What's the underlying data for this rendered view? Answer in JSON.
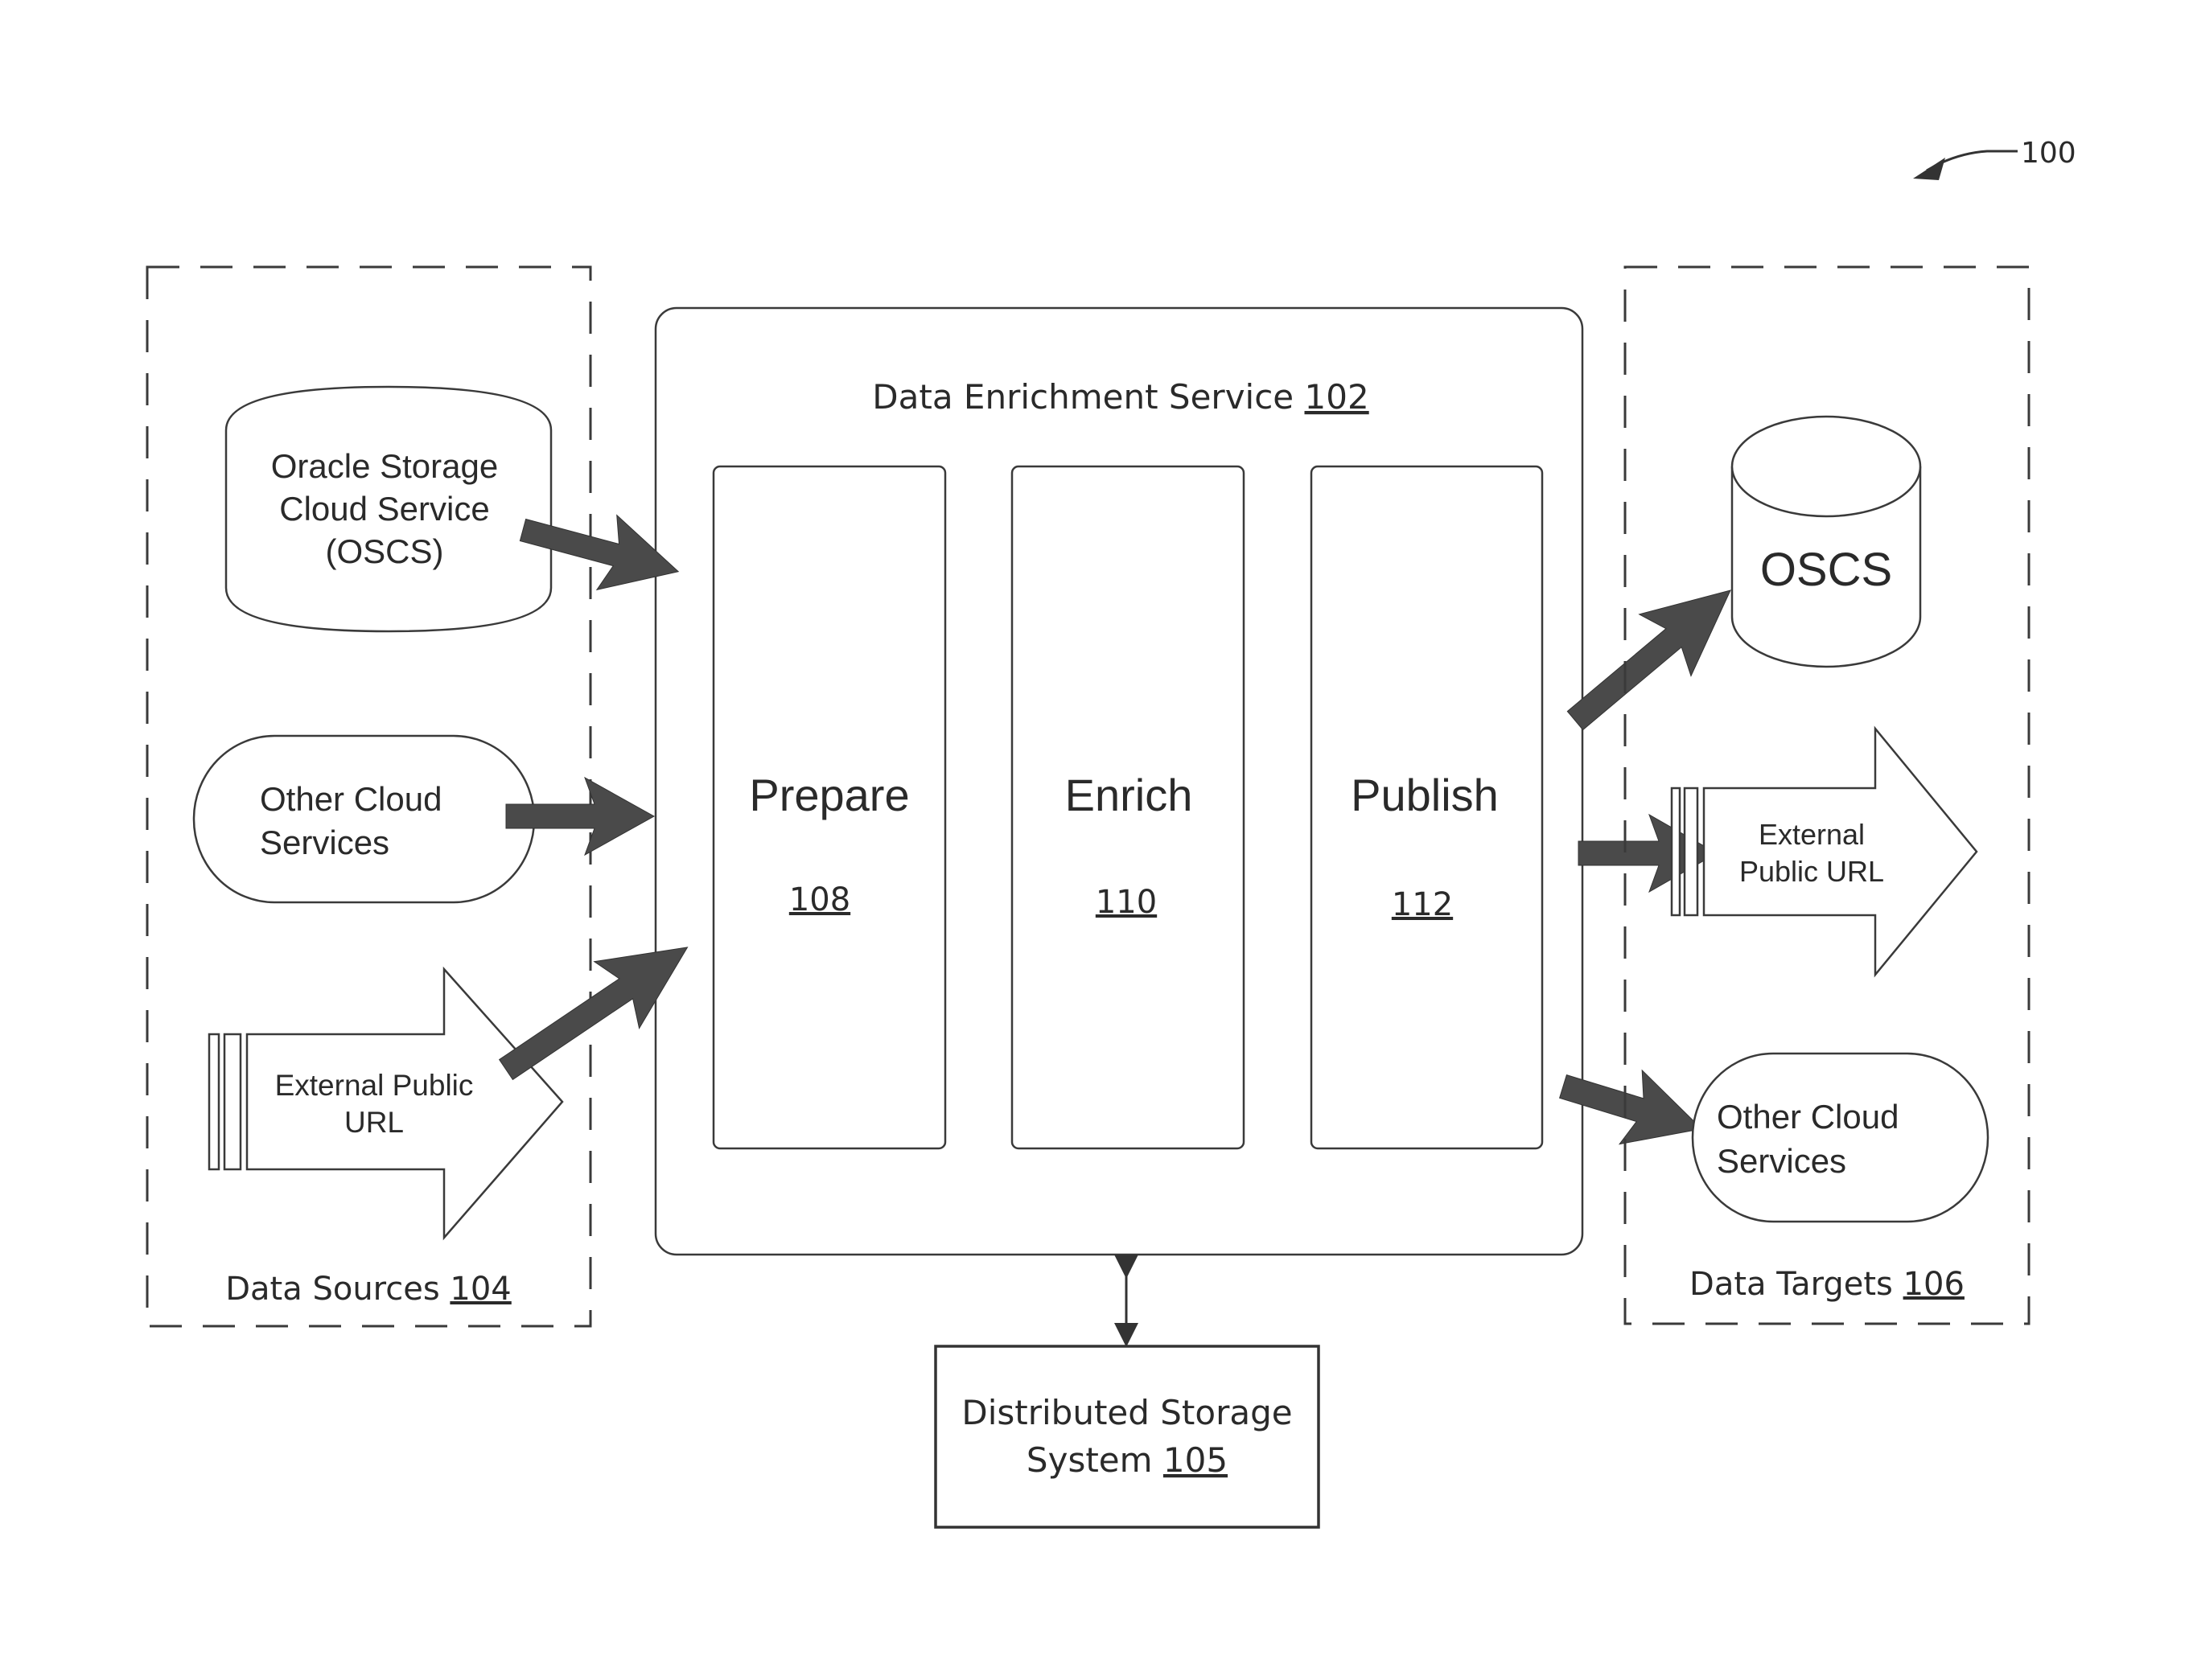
{
  "figure": {
    "reference": "100"
  },
  "data_sources": {
    "label": "Data Sources",
    "ref": "104",
    "items": [
      {
        "type": "cylinder",
        "lines": [
          "Oracle Storage",
          "Cloud Service",
          "(OSCS)"
        ]
      },
      {
        "type": "stadium",
        "lines": [
          "Other Cloud",
          "Services"
        ]
      },
      {
        "type": "url-arrow",
        "lines": [
          "External Public",
          "URL"
        ]
      }
    ]
  },
  "service": {
    "label": "Data Enrichment Service",
    "ref": "102",
    "stages": [
      {
        "label": "Prepare",
        "ref": "108"
      },
      {
        "label": "Enrich",
        "ref": "110"
      },
      {
        "label": "Publish",
        "ref": "112"
      }
    ]
  },
  "storage": {
    "line1": "Distributed Storage",
    "line2": "System",
    "ref": "105"
  },
  "data_targets": {
    "label": "Data Targets",
    "ref": "106",
    "items": [
      {
        "type": "cylinder",
        "lines": [
          "OSCS"
        ]
      },
      {
        "type": "url-arrow",
        "lines": [
          "External",
          "Public URL"
        ]
      },
      {
        "type": "stadium",
        "lines": [
          "Other Cloud",
          "Services"
        ]
      }
    ]
  }
}
